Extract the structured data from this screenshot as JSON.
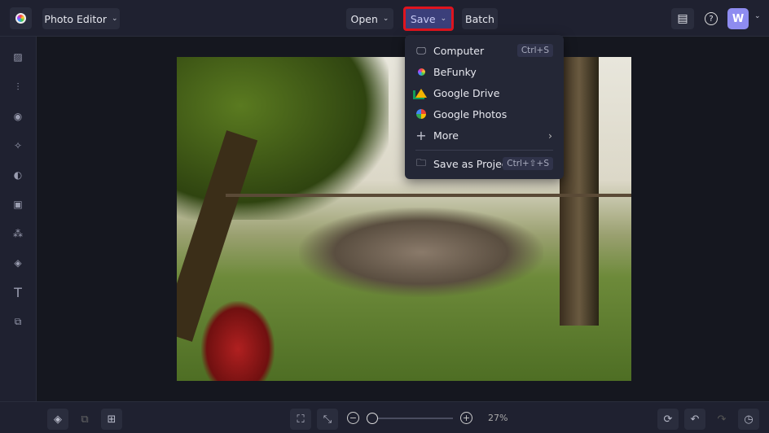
{
  "app": {
    "title": "Photo Editor",
    "user_initial": "W"
  },
  "toolbar": {
    "open": "Open",
    "save": "Save",
    "batch": "Batch"
  },
  "save_menu": {
    "items": [
      {
        "label": "Computer",
        "shortcut": "Ctrl+S",
        "icon": "monitor-icon"
      },
      {
        "label": "BeFunky",
        "icon": "befunky-icon"
      },
      {
        "label": "Google Drive",
        "icon": "google-drive-icon"
      },
      {
        "label": "Google Photos",
        "icon": "google-photos-icon"
      },
      {
        "label": "More",
        "icon": "plus-icon"
      },
      {
        "label": "Save as Project",
        "shortcut": "Ctrl+⇧+S",
        "icon": "folder-icon"
      }
    ]
  },
  "zoom": {
    "value": 27,
    "label": "27%"
  },
  "colors": {
    "accent": "#3b3f7a",
    "highlight": "#e0141e",
    "avatar": "#8e8cf0"
  }
}
